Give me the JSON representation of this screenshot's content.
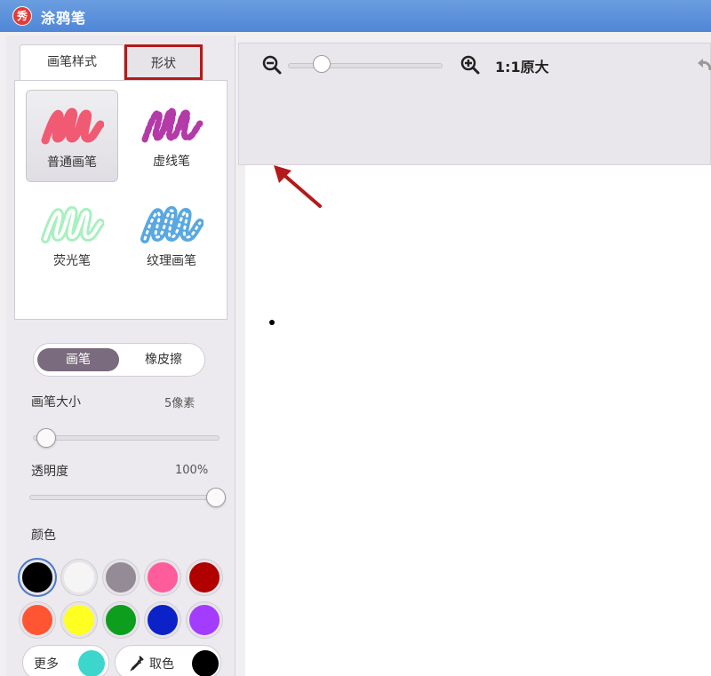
{
  "window": {
    "title": "涂鸦笔",
    "icon_char": "秀"
  },
  "tabs": {
    "brush_style": "画笔样式",
    "shape": "形状"
  },
  "brushes": [
    {
      "label": "普通画笔",
      "icon": "normal-brush-icon",
      "color": "#f05a73",
      "selected": true
    },
    {
      "label": "虚线笔",
      "icon": "dashed-brush-icon",
      "color": "#b43aa8",
      "selected": false
    },
    {
      "label": "荧光笔",
      "icon": "highlighter-brush-icon",
      "color": "#a8f0c0",
      "selected": false
    },
    {
      "label": "纹理画笔",
      "icon": "texture-brush-icon",
      "color": "#5aa8e0",
      "selected": false
    }
  ],
  "mode_toggle": {
    "brush": "画笔",
    "eraser": "橡皮擦",
    "active": "brush"
  },
  "brush_size": {
    "label": "画笔大小",
    "value_text": "5像素",
    "level": 0.05
  },
  "opacity": {
    "label": "透明度",
    "value_text": "100%",
    "level": 1.0
  },
  "color_section": {
    "label": "颜色",
    "swatches": [
      "#000000",
      "#f5f5f5",
      "#958b96",
      "#ff5c9c",
      "#b00000",
      "#ff5533",
      "#ffff22",
      "#0d9e1e",
      "#0a22c8",
      "#a33cff"
    ],
    "selected_index": 0
  },
  "more_colors": {
    "label": "更多",
    "color": "#3dd6cc"
  },
  "pick_color": {
    "label": "取色",
    "color": "#000000"
  },
  "toolbar": {
    "zoom_label": "1:1原大",
    "zoom_level": 0.2
  },
  "colors": {
    "accent": "#7a6b7e",
    "highlight_box": "#b41a1a",
    "annotation_arrow": "#b41a1a"
  }
}
